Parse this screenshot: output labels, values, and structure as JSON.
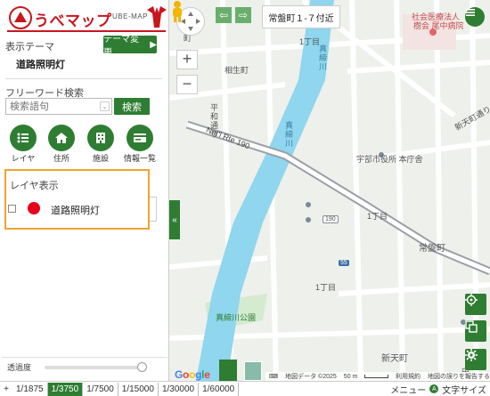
{
  "app": {
    "name": "うべマップ",
    "sub": "UBE-MAP"
  },
  "panel": {
    "theme_label": "表示テーマ",
    "theme_button": "テーマ変更",
    "theme_value": "道路照明灯",
    "keyword_label": "フリーワード検索",
    "keyword_placeholder": "検索語句",
    "search_button": "検索",
    "quick": [
      {
        "label": "レイヤ",
        "icon": "list-icon"
      },
      {
        "label": "住所",
        "icon": "home-icon"
      },
      {
        "label": "施設",
        "icon": "building-icon"
      },
      {
        "label": "情報一覧",
        "icon": "card-icon"
      }
    ],
    "layer_title": "レイヤ表示",
    "layer_item": {
      "name": "道路照明灯",
      "color": "#e6001a",
      "checked": false
    },
    "opacity_label": "透過度",
    "opacity_value": 1.0
  },
  "map": {
    "location": "常盤町１-７付近",
    "labels": {
      "hospital": "社会医療法人",
      "hospital2": "樹会 尾中病院",
      "aioi": "相生町",
      "city_hall": "宇部市役所 本庁舎",
      "tokiwa": "常盤町",
      "chome1a": "1丁目",
      "chome1b": "1丁目",
      "chome1c": "1丁目",
      "park": "真締川公園",
      "shintsubo": "新天町",
      "naka": "中",
      "route": "Nat'l Rte 190",
      "shield190": "190",
      "shield55": "55",
      "river_a": "真締川",
      "river_b": "真締川",
      "heiwa": "平和通り",
      "shintenmachi": "新天町通り",
      "nishi": "西本町"
    },
    "attribution": {
      "data": "地図データ ©2025",
      "scale": "50 m",
      "terms": "利用規約",
      "report": "地図の誤りを報告する"
    },
    "google": [
      "G",
      "o",
      "o",
      "g",
      "l",
      "e"
    ]
  },
  "bottom": {
    "plus": "+",
    "scales": [
      "1/1875",
      "1/3750",
      "1/7500",
      "1/15000",
      "1/30000",
      "1/60000"
    ],
    "active": 1,
    "menu": "メニュー",
    "font_size": "文字サイズ"
  }
}
